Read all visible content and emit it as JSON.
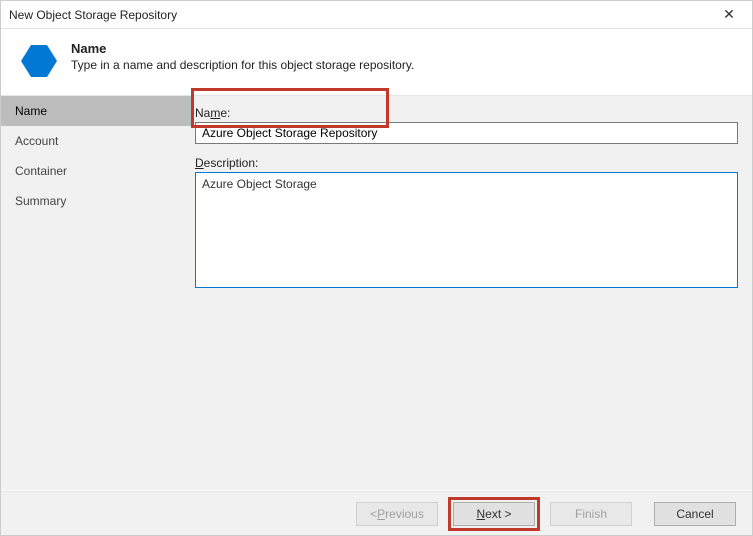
{
  "window": {
    "title": "New Object Storage Repository"
  },
  "header": {
    "title": "Name",
    "subtitle": "Type in a name and description for this object storage repository."
  },
  "sidebar": {
    "items": [
      {
        "label": "Name"
      },
      {
        "label": "Account"
      },
      {
        "label": "Container"
      },
      {
        "label": "Summary"
      }
    ]
  },
  "form": {
    "name_label_pre": "Na",
    "name_label_u": "m",
    "name_label_post": "e:",
    "name_value": "Azure Object Storage Repository",
    "desc_label_u": "D",
    "desc_label_post": "escription:",
    "desc_value": "Azure Object Storage"
  },
  "buttons": {
    "previous_pre": "< ",
    "previous_u": "P",
    "previous_post": "revious",
    "next_u": "N",
    "next_post": "ext >",
    "finish": "Finish",
    "cancel": "Cancel"
  }
}
